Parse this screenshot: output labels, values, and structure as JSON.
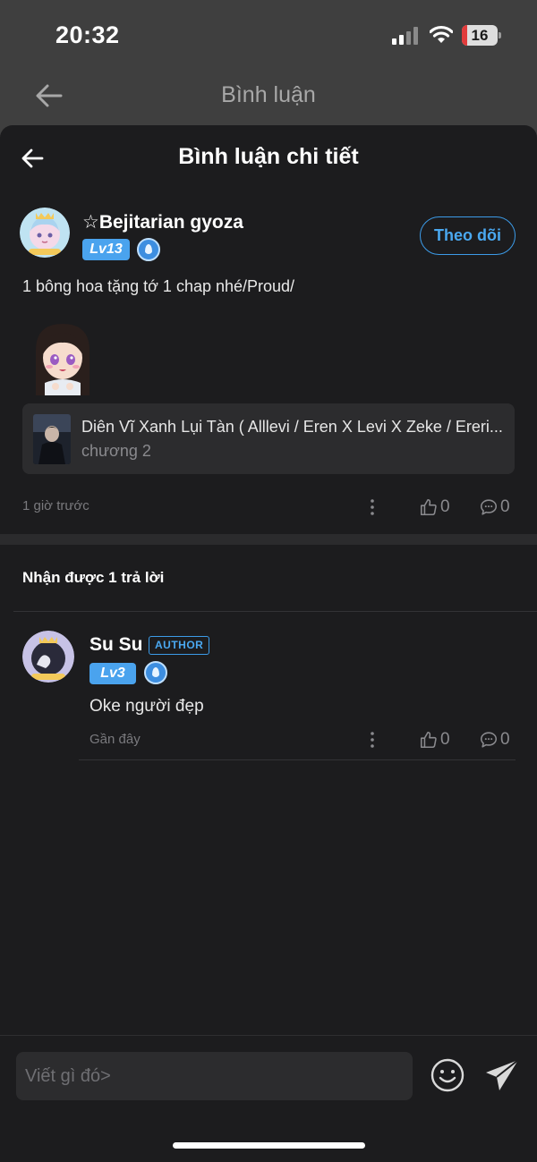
{
  "status_bar": {
    "time": "20:32",
    "battery": "16",
    "battery_level": 0.16,
    "battery_color": "#e23b3b"
  },
  "parent": {
    "title": "Bình luận"
  },
  "sheet": {
    "title": "Bình luận chi tiết"
  },
  "comment": {
    "username": "☆Bejitarian gyoza",
    "level": "Lv13",
    "follow_label": "Theo dõi",
    "text": "1 bông hoa tặng tớ 1 chap nhé/Proud/",
    "story": {
      "title": "Diên Vĩ Xanh Lụi Tàn ( Alllevi / Eren X Levi X Zeke / Ereri...",
      "chapter": "chương 2"
    },
    "time": "1 giờ trước",
    "likes": "0",
    "replies": "0"
  },
  "replies_section": {
    "header": "Nhận được 1 trả lời",
    "items": [
      {
        "username": "Su Su",
        "tag": "AUTHOR",
        "level": "Lv3",
        "text": "Oke người đẹp",
        "time": "Gần đây",
        "likes": "0",
        "replies": "0"
      }
    ]
  },
  "input": {
    "placeholder": "Viết gì đó>"
  },
  "colors": {
    "accent": "#4aa8f0",
    "level_badge": "#4aa3ee",
    "sheet_bg": "#1c1c1e",
    "card_bg": "#2c2c2e"
  }
}
